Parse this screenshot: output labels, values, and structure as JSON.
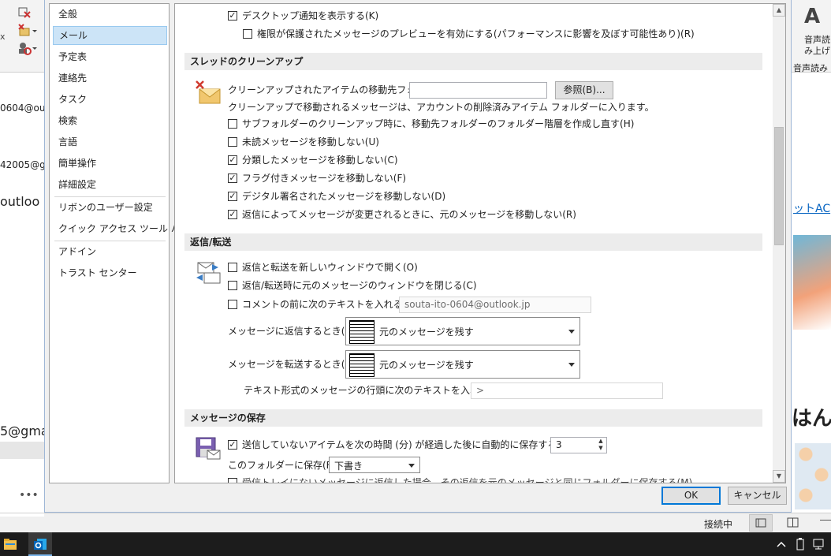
{
  "background": {
    "left_emails": [
      "0604@outlo",
      "42005@gm",
      "outloo",
      "5@gma"
    ],
    "left_more": "•••",
    "right_ribbon": [
      "A",
      "音声読",
      "み上げ",
      "音声読み"
    ],
    "right_link": "ットAC",
    "right_text": "はんか"
  },
  "nav": {
    "items": [
      "全般",
      "メール",
      "予定表",
      "連絡先",
      "タスク",
      "検索",
      "言語",
      "簡単操作",
      "詳細設定",
      "リボンのユーザー設定",
      "クイック アクセス ツール バー",
      "アドイン",
      "トラスト センター"
    ],
    "selected": "メール"
  },
  "top": {
    "desktop_notify": "デスクトップ通知を表示する(K)",
    "protected_preview": "権限が保護されたメッセージのプレビューを有効にする(パフォーマンスに影響を及ぼす可能性あり)(R)"
  },
  "cleanup": {
    "title": "スレッドのクリーンアップ",
    "folder_label": "クリーンアップされたアイテムの移動先フォルダー：",
    "folder_value": "",
    "browse_button": "参照(B)...",
    "note": "クリーンアップで移動されるメッセージは、アカウントの削除済みアイテム フォルダーに入ります。",
    "options": [
      {
        "label": "サブフォルダーのクリーンアップ時に、移動先フォルダーのフォルダー階層を作成し直す(H)",
        "checked": false
      },
      {
        "label": "未読メッセージを移動しない(U)",
        "checked": false
      },
      {
        "label": "分類したメッセージを移動しない(C)",
        "checked": true
      },
      {
        "label": "フラグ付きメッセージを移動しない(F)",
        "checked": true
      },
      {
        "label": "デジタル署名されたメッセージを移動しない(D)",
        "checked": true
      },
      {
        "label": "返信によってメッセージが変更されるときに、元のメッセージを移動しない(R)",
        "checked": true
      }
    ]
  },
  "reply": {
    "title": "返信/転送",
    "options": [
      {
        "label": "返信と転送を新しいウィンドウで開く(O)",
        "checked": false
      },
      {
        "label": "返信/転送時に元のメッセージのウィンドウを閉じる(C)",
        "checked": false
      },
      {
        "label": "コメントの前に次のテキストを入れる(A):",
        "checked": false
      }
    ],
    "comment_text": "souta-ito-0604@outlook.jp",
    "reply_label": "メッセージに返信するとき(R):",
    "reply_value": "元のメッセージを残す",
    "forward_label": "メッセージを転送するとき(F):",
    "forward_value": "元のメッセージを残す",
    "prefix_label": "テキスト形式のメッセージの行頭に次のテキストを入れる(P):",
    "prefix_value": ">"
  },
  "save": {
    "title": "メッセージの保存",
    "autosave_label": "送信していないアイテムを次の時間 (分) が経過した後に自動的に保存する(S):",
    "autosave_checked": true,
    "autosave_value": "3",
    "folder_label": "このフォルダーに保存(F):",
    "folder_value": "下書き",
    "cut_label": "受信トレイにないメッセージに返信した場合、その返信を元のメッセージと同じフォルダーに保存する(M)"
  },
  "buttons": {
    "ok": "OK",
    "cancel": "キャンセル"
  },
  "status": {
    "connection": "接続中"
  },
  "colors": {
    "accent": "#0078d7",
    "selection": "#cce4f7",
    "taskbar": "#1c1c1c"
  }
}
